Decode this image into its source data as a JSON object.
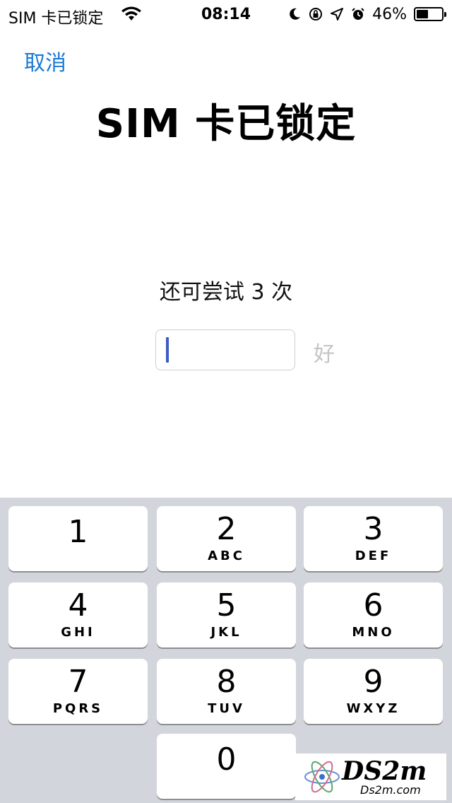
{
  "status_bar": {
    "carrier": "SIM 卡已锁定",
    "time": "08:14",
    "battery_percent": "46%",
    "battery_level": 0.46,
    "icons": [
      "wifi-icon",
      "moon-icon",
      "rotation-lock-icon",
      "location-icon",
      "alarm-icon",
      "battery-icon"
    ]
  },
  "nav": {
    "cancel_label": "取消"
  },
  "title": "SIM 卡已锁定",
  "attempts_text": "还可尝试 3 次",
  "pin_field": {
    "value": ""
  },
  "ok_label": "好",
  "keypad": {
    "keys": [
      {
        "digit": "1",
        "letters": ""
      },
      {
        "digit": "2",
        "letters": "ABC"
      },
      {
        "digit": "3",
        "letters": "DEF"
      },
      {
        "digit": "4",
        "letters": "GHI"
      },
      {
        "digit": "5",
        "letters": "JKL"
      },
      {
        "digit": "6",
        "letters": "MNO"
      },
      {
        "digit": "7",
        "letters": "PQRS"
      },
      {
        "digit": "8",
        "letters": "TUV"
      },
      {
        "digit": "9",
        "letters": "WXYZ"
      },
      {
        "digit": "0",
        "letters": ""
      }
    ]
  },
  "watermark": {
    "big": "DS2m",
    "small": "Ds2m.com"
  },
  "colors": {
    "accent": "#1a7ad4",
    "keypad_bg": "#d2d5db",
    "caret": "#3b5cc6",
    "disabled": "#c4c4c4"
  }
}
